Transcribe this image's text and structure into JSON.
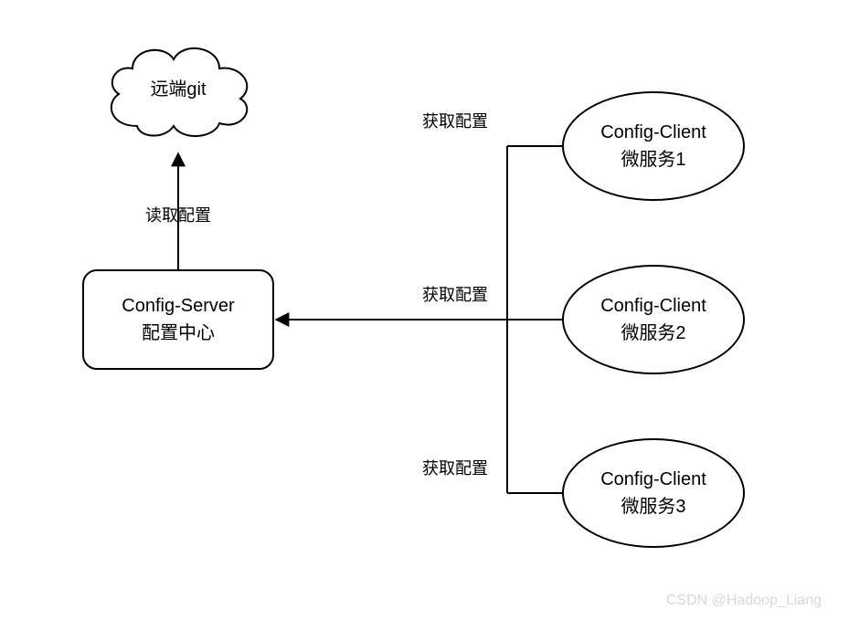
{
  "nodes": {
    "cloud": {
      "label": "远端git"
    },
    "server": {
      "line1": "Config-Server",
      "line2": "配置中心"
    },
    "client1": {
      "line1": "Config-Client",
      "line2": "微服务1"
    },
    "client2": {
      "line1": "Config-Client",
      "line2": "微服务2"
    },
    "client3": {
      "line1": "Config-Client",
      "line2": "微服务3"
    }
  },
  "edges": {
    "read_config": "读取配置",
    "get_config_1": "获取配置",
    "get_config_2": "获取配置",
    "get_config_3": "获取配置"
  },
  "watermark": "CSDN @Hadoop_Liang"
}
